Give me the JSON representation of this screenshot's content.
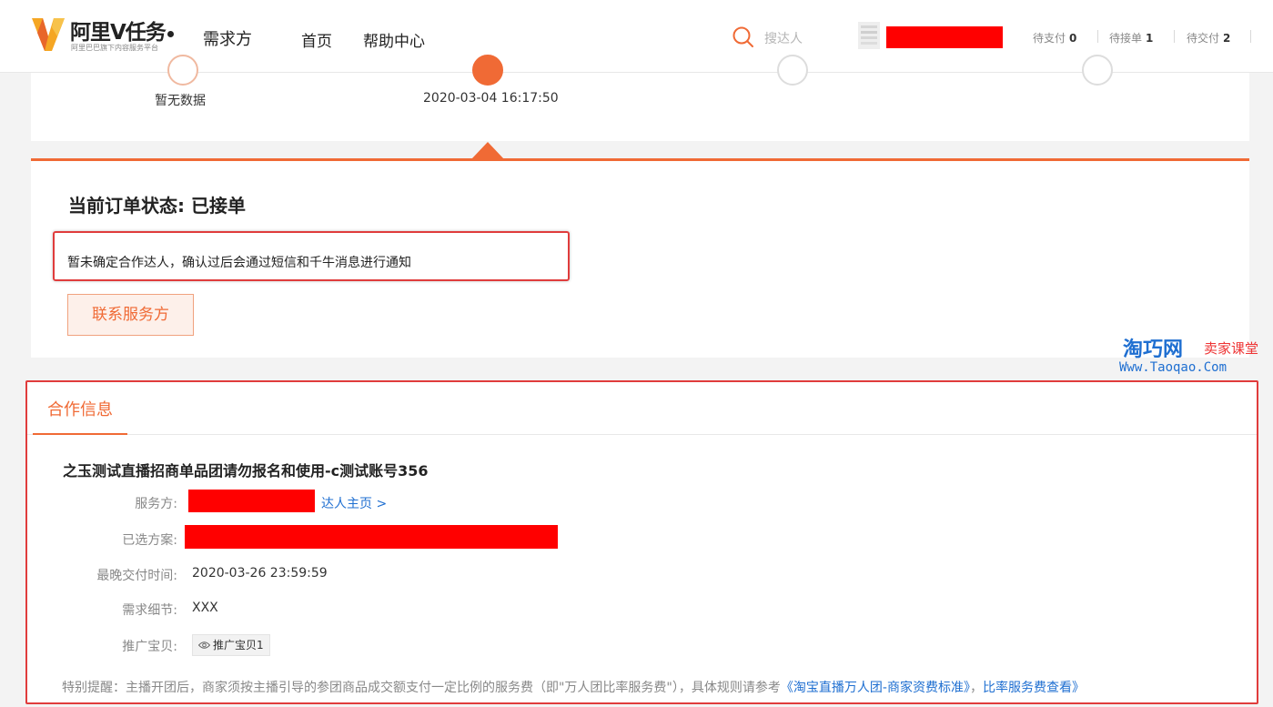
{
  "header": {
    "logo_title": "阿里V任务",
    "logo_subtitle": "阿里巴巴旗下内容服务平台",
    "role": "需求方",
    "nav": {
      "home": "首页",
      "help": "帮助中心"
    },
    "search_placeholder": "搜达人",
    "stats": [
      {
        "label": "待支付",
        "count": "0"
      },
      {
        "label": "待接单",
        "count": "1"
      },
      {
        "label": "待交付",
        "count": "2"
      }
    ]
  },
  "progress": {
    "steps": [
      {
        "date": "暂无数据"
      },
      {
        "date": "2020-03-04 16:17:50"
      }
    ]
  },
  "status": {
    "title": "当前订单状态: 已接单",
    "notice": "暂未确定合作达人，确认过后会通过短信和千牛消息进行通知",
    "contact_button": "联系服务方"
  },
  "watermark": {
    "brand": "淘巧网",
    "tag": "卖家课堂",
    "url": "Www.Taoqao.Com"
  },
  "cooperation": {
    "tab": "合作信息",
    "name": "之玉测试直播招商单品团请勿报名和使用-c测试账号356",
    "rows": {
      "provider_label": "服务方:",
      "provider_link": "达人主页 >",
      "plan_label": "已选方案:",
      "deadline_label": "最晚交付时间:",
      "deadline_value": "2020-03-26 23:59:59",
      "detail_label": "需求细节:",
      "detail_value": "XXX",
      "item_label": "推广宝贝:",
      "item_value": "推广宝贝1"
    },
    "footnote_prefix": "特别提醒：主播开团后，商家须按主播引导的参团商品成交额支付一定比例的服务费（即\"万人团比率服务费\"），具体规则请参考",
    "footnote_link1": "《淘宝直播万人团-商家资费标准》",
    "footnote_sep": "，",
    "footnote_link2": "比率服务费查看》"
  },
  "colors": {
    "accent": "#f06a35",
    "highlight_border": "#e03c3c",
    "redaction": "#ff0000",
    "link": "#1f6fd1"
  }
}
